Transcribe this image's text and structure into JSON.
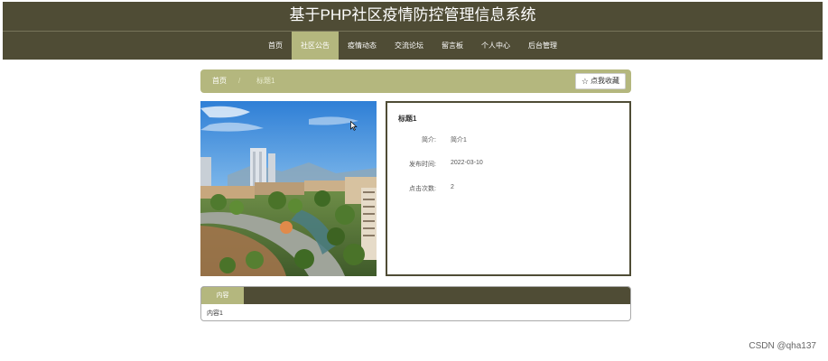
{
  "header": {
    "title": "基于PHP社区疫情防控管理信息系统",
    "nav": [
      {
        "label": "首页",
        "active": false
      },
      {
        "label": "社区公告",
        "active": true
      },
      {
        "label": "疫情动态",
        "active": false
      },
      {
        "label": "交流论坛",
        "active": false
      },
      {
        "label": "留言板",
        "active": false
      },
      {
        "label": "个人中心",
        "active": false
      },
      {
        "label": "后台管理",
        "active": false
      }
    ]
  },
  "breadcrumb": {
    "home": "首页",
    "separator": "/",
    "current": "标题1",
    "favorite_label": "点我收藏"
  },
  "detail": {
    "title": "标题1",
    "fields": [
      {
        "label": "简介:",
        "value": "简介1"
      },
      {
        "label": "发布时间:",
        "value": "2022-03-10"
      },
      {
        "label": "点击次数:",
        "value": "2"
      }
    ]
  },
  "content": {
    "tab_label": "内容",
    "text": "内容1"
  },
  "watermark": "CSDN @qha137",
  "colors": {
    "header_bg": "#4f4c35",
    "accent": "#b4b77e",
    "background": "#ffffff"
  },
  "icons": {
    "favorite": "star-outline-icon",
    "cursor": "mouse-pointer-icon"
  }
}
